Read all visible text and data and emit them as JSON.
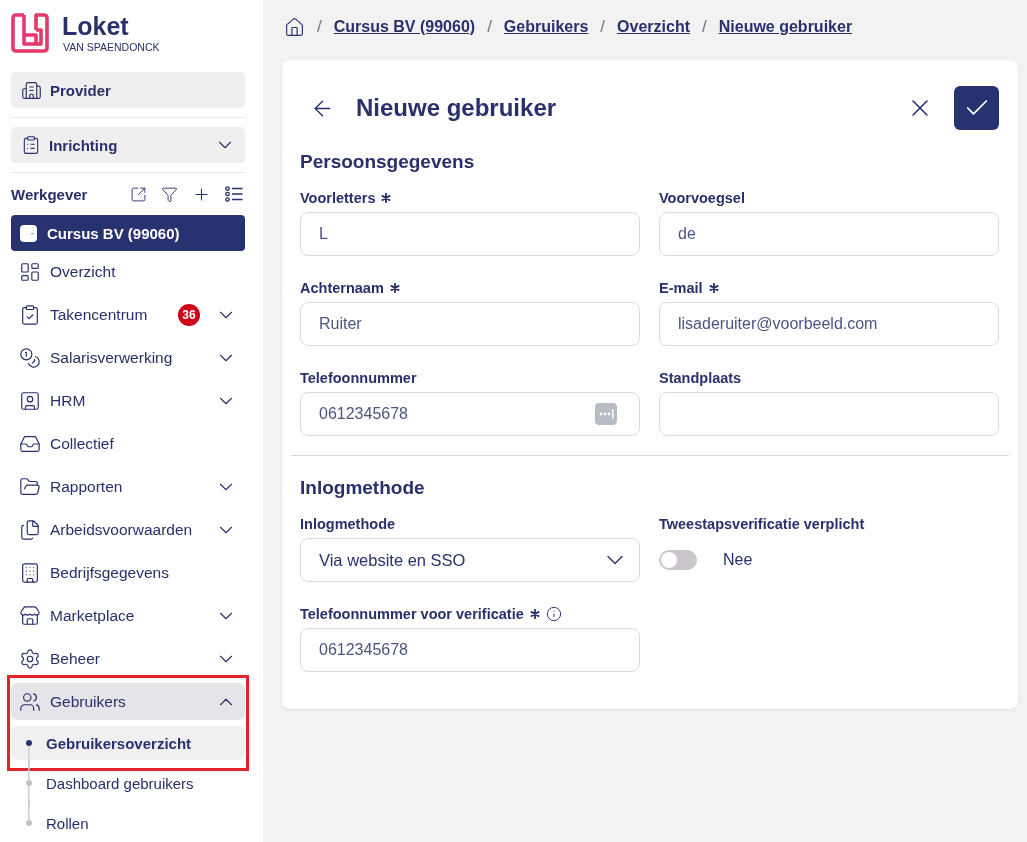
{
  "logo": {
    "name": "Loket",
    "subtitle": "VAN SPAENDONCK"
  },
  "sidebar": {
    "top_items": [
      {
        "label": "Provider",
        "kind": "link"
      },
      {
        "label": "Inrichting",
        "kind": "dropdown",
        "expanded": false
      }
    ],
    "employer": {
      "title": "Werkgever",
      "current": {
        "label": "Cursus BV (99060)",
        "selected": true
      }
    },
    "nav": [
      {
        "label": "Overzicht",
        "kind": "link",
        "highlighted": false
      },
      {
        "label": "Takencentrum",
        "kind": "group",
        "expanded": false,
        "badge": "36",
        "highlighted": false
      },
      {
        "label": "Salarisverwerking",
        "kind": "group",
        "expanded": false,
        "highlighted": false
      },
      {
        "label": "HRM",
        "kind": "group",
        "expanded": false,
        "highlighted": false
      },
      {
        "label": "Collectief",
        "kind": "link",
        "highlighted": false
      },
      {
        "label": "Rapporten",
        "kind": "group",
        "expanded": false,
        "highlighted": false
      },
      {
        "label": "Arbeidsvoorwaarden",
        "kind": "group",
        "expanded": false,
        "highlighted": false
      },
      {
        "label": "Bedrijfsgegevens",
        "kind": "link",
        "highlighted": false
      },
      {
        "label": "Marketplace",
        "kind": "group",
        "expanded": false,
        "highlighted": false
      },
      {
        "label": "Beheer",
        "kind": "group",
        "expanded": false,
        "highlighted": false
      },
      {
        "label": "Gebruikers",
        "kind": "group",
        "expanded": true,
        "highlighted": true,
        "children": [
          {
            "label": "Gebruikersoverzicht",
            "selected": true,
            "highlighted": true
          },
          {
            "label": "Dashboard gebruikers",
            "selected": false,
            "highlighted": false
          },
          {
            "label": "Rollen",
            "selected": false,
            "highlighted": false
          }
        ]
      }
    ]
  },
  "breadcrumb": [
    {
      "separator": "/",
      "label": "Cursus BV (99060)"
    },
    {
      "separator": "/",
      "label": "Gebruikers"
    },
    {
      "separator": "/",
      "label": "Overzicht"
    },
    {
      "separator": "/",
      "label": "Nieuwe gebruiker"
    }
  ],
  "form": {
    "title": "Nieuwe gebruiker",
    "sections": [
      {
        "title": "Persoonsgegevens",
        "fields": [
          {
            "label": "Voorletters",
            "required": true,
            "kind": "text",
            "value": "L"
          },
          {
            "label": "Voorvoegsel",
            "required": false,
            "kind": "text",
            "value": "de"
          },
          {
            "label": "Achternaam",
            "required": true,
            "kind": "text",
            "value": "Ruiter"
          },
          {
            "label": "E-mail",
            "required": true,
            "kind": "text",
            "value": "lisaderuiter@voorbeeld.com"
          },
          {
            "label": "Telefoonnummer",
            "required": false,
            "kind": "text",
            "value": "0612345678",
            "autofill": true
          },
          {
            "label": "Standplaats",
            "required": false,
            "kind": "text"
          }
        ]
      },
      {
        "title": "Inlogmethode",
        "fields": [
          {
            "label": "Inlogmethode",
            "required": false,
            "kind": "select",
            "value": "Via website en SSO"
          },
          {
            "label": "Tweestapsverificatie verplicht",
            "required": false,
            "kind": "toggle",
            "on": false,
            "state_label": "Nee"
          },
          {
            "label": "Telefoonnummer voor verificatie",
            "required": true,
            "info": true,
            "kind": "text",
            "value": "0612345678"
          }
        ]
      }
    ]
  }
}
